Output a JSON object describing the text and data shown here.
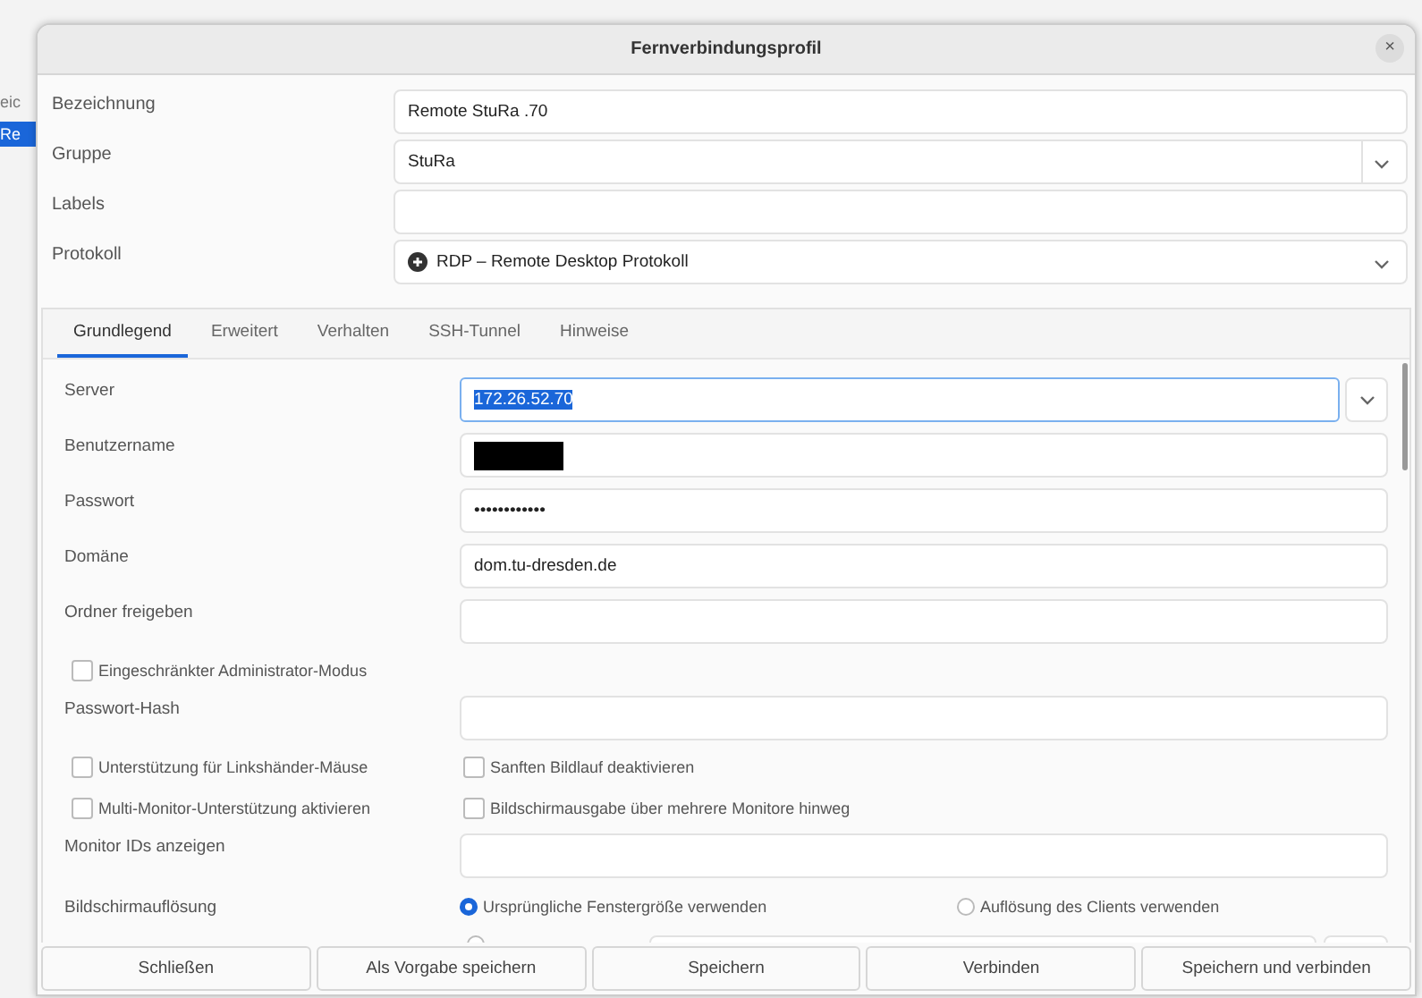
{
  "background_window": {
    "items": [
      {
        "label": "eic",
        "selected": false
      },
      {
        "label": "Re",
        "selected": true
      }
    ]
  },
  "window": {
    "title": "Fernverbindungsprofil",
    "close": "×"
  },
  "profile_fields": [
    {
      "label": "Bezeichnung",
      "kind": "entry",
      "value": "Remote StuRa .70"
    },
    {
      "label": "Gruppe",
      "kind": "combo",
      "value": "StuRa"
    },
    {
      "label": "Labels",
      "kind": "entry"
    },
    {
      "label": "Protokoll",
      "kind": "protocol",
      "value": "RDP – Remote Desktop Protokoll"
    }
  ],
  "tabs": [
    {
      "label": "Grundlegend",
      "selected": true
    },
    {
      "label": "Erweitert",
      "selected": false
    },
    {
      "label": "Verhalten",
      "selected": false
    },
    {
      "label": "SSH-Tunnel",
      "selected": false
    },
    {
      "label": "Hinweise",
      "selected": false
    }
  ],
  "settings": [
    {
      "kind": "combo",
      "label": "Server",
      "value": "172.26.52.70",
      "focused": true
    },
    {
      "kind": "redacted",
      "label": "Benutzername"
    },
    {
      "kind": "entry",
      "label": "Passwort",
      "value": "••••••••••••"
    },
    {
      "kind": "entry",
      "label": "Domäne",
      "value": "dom.tu-dresden.de"
    },
    {
      "kind": "entry",
      "label": "Ordner freigeben"
    },
    {
      "kind": "checkbox",
      "options": [
        {
          "label": "Eingeschränkter Administrator-Modus",
          "checked": false
        }
      ]
    },
    {
      "kind": "entry",
      "label": "Passwort-Hash"
    },
    {
      "kind": "checkbox",
      "options": [
        {
          "label": "Unterstützung für Linkshänder-Mäuse",
          "checked": false
        },
        {
          "label": "Sanften Bildlauf deaktivieren",
          "checked": false
        }
      ]
    },
    {
      "kind": "checkbox",
      "options": [
        {
          "label": "Multi-Monitor-Unterstützung aktivieren",
          "checked": false
        },
        {
          "label": "Bildschirmausgabe über mehrere Monitore hinweg",
          "checked": false
        }
      ]
    },
    {
      "kind": "entry",
      "label": "Monitor IDs anzeigen"
    },
    {
      "kind": "radio",
      "label": "Bildschirmauflösung",
      "options": [
        {
          "label": "Ursprüngliche Fenstergröße verwenden",
          "selected": true
        },
        {
          "label": "Auflösung des Clients verwenden",
          "selected": false
        }
      ]
    },
    {
      "kind": "partial",
      "selected": false
    }
  ],
  "buttons": [
    "Schließen",
    "Als Vorgabe speichern",
    "Speichern",
    "Verbinden",
    "Speichern und verbinden"
  ]
}
